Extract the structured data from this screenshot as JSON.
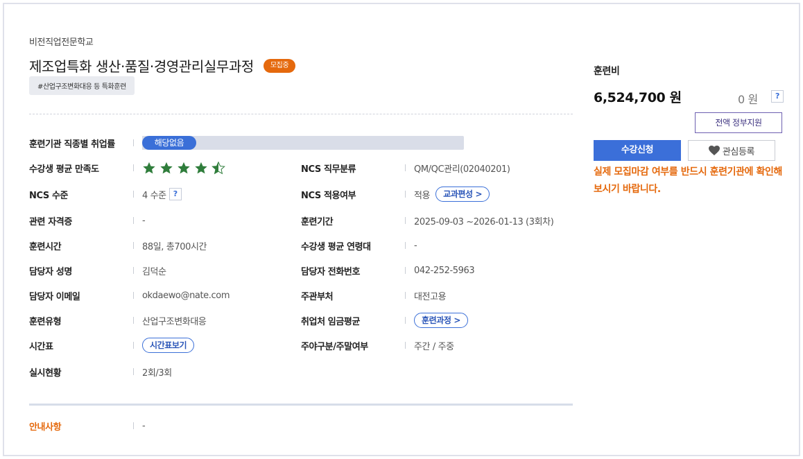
{
  "header": {
    "school": "비전직업전문학교",
    "title": "제조업특화 생산·품질·경영관리실무과정",
    "status_badge": "모집중",
    "tag": "#산업구조변화대응 등 특화훈련"
  },
  "details": {
    "employment_rate_label": "훈련기관 직종별 취업률",
    "employment_rate_value": "해당없음",
    "satisfaction_label": "수강생 평균 만족도",
    "satisfaction_stars": 4.5,
    "ncs_category_label": "NCS 직무분류",
    "ncs_category_value": "QM/QC관리(02040201)",
    "ncs_level_label": "NCS 수준",
    "ncs_level_value": "4 수준",
    "ncs_apply_label": "NCS 적용여부",
    "ncs_apply_value": "적용",
    "ncs_apply_link": "교과편성 >",
    "cert_label": "관련 자격증",
    "cert_value": "-",
    "period_label": "훈련기간",
    "period_value": "2025-09-03 ~2026-01-13 (3회차)",
    "hours_label": "훈련시간",
    "hours_value": "88일, 총700시간",
    "age_label": "수강생 평균 연령대",
    "age_value": "-",
    "manager_label": "담당자 성명",
    "manager_value": "김덕순",
    "phone_label": "담당자 전화번호",
    "phone_value": "042-252-5963",
    "email_label": "담당자 이메일",
    "email_value": "okdaewo@nate.com",
    "dept_label": "주관부처",
    "dept_value": "대전고용",
    "type_label": "훈련유형",
    "type_value": "산업구조변화대응",
    "wage_label": "취업처 임금평균",
    "wage_link": "훈련과정 >",
    "schedule_label": "시간표",
    "schedule_link": "시간표보기",
    "daynight_label": "주야구분/주말여부",
    "daynight_value": "주간 / 주중",
    "progress_label": "실시현황",
    "progress_value": "2회/3회",
    "notice_label": "안내사항",
    "notice_value": "-"
  },
  "sidebar": {
    "fee_label": "훈련비",
    "fee_value": "6,524,700 원",
    "self_pay": "0 원",
    "help": "?",
    "gov_support": "전액 정부지원",
    "apply": "수강신청",
    "favorite": "관심등록",
    "warning": "실제 모집마감 여부를 반드시 훈련기관에 확인해보시기 바랍니다."
  },
  "colors": {
    "accent_blue": "#3b6fd9",
    "accent_orange": "#e5690d",
    "star_green": "#2f7d3b"
  }
}
